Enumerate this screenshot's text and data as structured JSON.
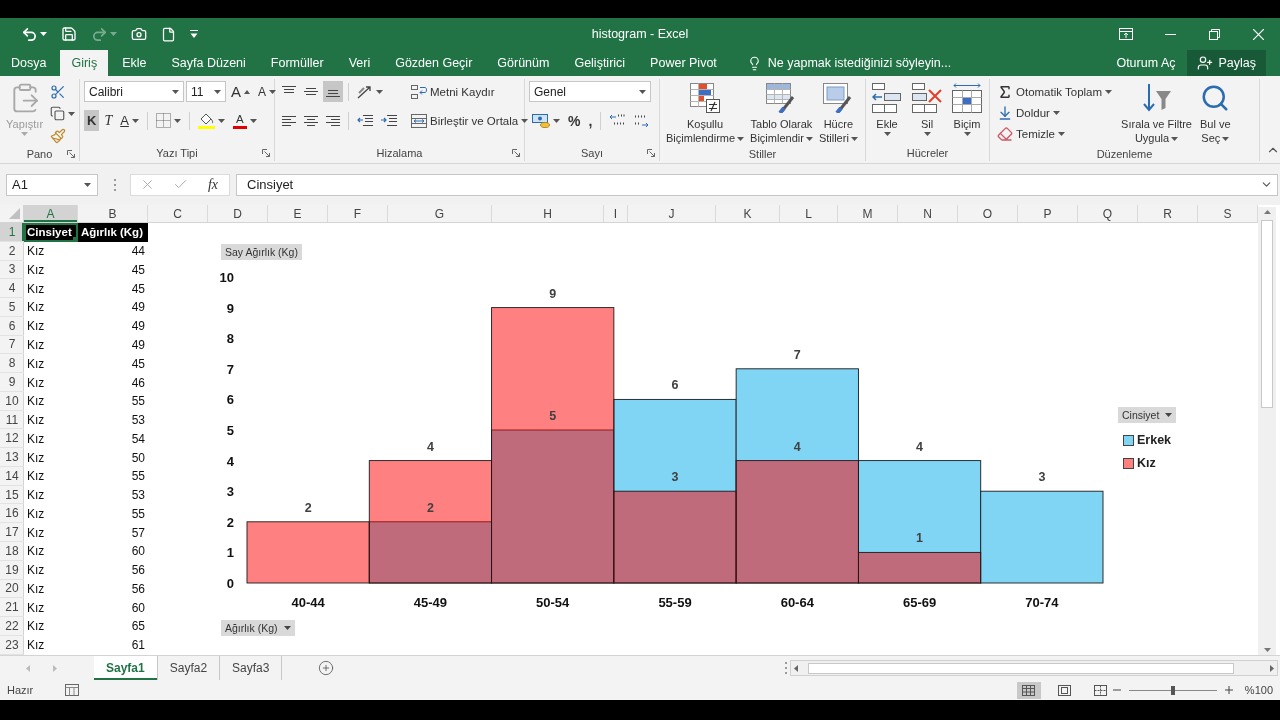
{
  "quick_access": [
    {
      "kind": "undo",
      "disabled": false
    },
    {
      "kind": "save",
      "disabled": false
    },
    {
      "kind": "redo",
      "disabled": true
    },
    {
      "kind": "camera",
      "disabled": false
    },
    {
      "kind": "new",
      "disabled": false
    },
    {
      "kind": "customize",
      "disabled": false
    }
  ],
  "window": {
    "title": "histogram - Excel"
  },
  "menu_tabs": [
    {
      "label": "Dosya",
      "selected": false
    },
    {
      "label": "Giriş",
      "selected": true
    },
    {
      "label": "Ekle",
      "selected": false
    },
    {
      "label": "Sayfa Düzeni",
      "selected": false
    },
    {
      "label": "Formüller",
      "selected": false
    },
    {
      "label": "Veri",
      "selected": false
    },
    {
      "label": "Gözden Geçir",
      "selected": false
    },
    {
      "label": "Görünüm",
      "selected": false
    },
    {
      "label": "Geliştirici",
      "selected": false
    },
    {
      "label": "Power Pivot",
      "selected": false
    }
  ],
  "tell_me": {
    "placeholder": "Ne yapmak istediğinizi söyleyin..."
  },
  "account": {
    "sign_in": "Oturum Aç",
    "share": "Paylaş"
  },
  "ribbon": {
    "clipboard": {
      "label": "Pano",
      "paste": {
        "label": "Yapıştır",
        "disabled": true
      }
    },
    "font": {
      "label": "Yazı Tipi",
      "font_name": "Calibri",
      "font_size": "11",
      "grow": "A",
      "shrink": "A",
      "bold": {
        "label": "K",
        "selected": true
      },
      "italic": {
        "label": "T",
        "selected": false
      },
      "underline": {
        "label": "A",
        "selected": false
      },
      "font_color": "A"
    },
    "alignment": {
      "label": "Hizalama",
      "vertical": [
        {
          "kind": "top",
          "selected": false
        },
        {
          "kind": "middle",
          "selected": false
        },
        {
          "kind": "bottom",
          "selected": true
        }
      ],
      "horizontal": [
        {
          "kind": "left",
          "selected": false
        },
        {
          "kind": "center",
          "selected": false
        },
        {
          "kind": "right",
          "selected": false
        }
      ],
      "wrap_text": "Metni Kaydır",
      "merge": "Birleştir ve Ortala"
    },
    "number": {
      "label": "Sayı",
      "format": "Genel",
      "percent": "%",
      "comma": ","
    },
    "styles": {
      "label": "Stiller",
      "buttons": [
        {
          "kind": "conditional",
          "lines": [
            "Koşullu",
            "Biçimlendirme"
          ]
        },
        {
          "kind": "table",
          "lines": [
            "Tablo Olarak",
            "Biçimlendir"
          ]
        },
        {
          "kind": "cell_styles",
          "lines": [
            "Hücre",
            "Stilleri"
          ]
        }
      ]
    },
    "cells": {
      "label": "Hücreler",
      "buttons": [
        {
          "kind": "insert",
          "label": "Ekle"
        },
        {
          "kind": "delete",
          "label": "Sil"
        },
        {
          "kind": "format",
          "label": "Biçim"
        }
      ]
    },
    "editing": {
      "label": "Düzenleme",
      "small": [
        {
          "kind": "autosum",
          "label": "Otomatik Toplam"
        },
        {
          "kind": "fill",
          "label": "Doldur"
        },
        {
          "kind": "clear",
          "label": "Temizle"
        }
      ],
      "big": [
        {
          "kind": "sort",
          "lines": [
            "Sırala ve Filtre",
            "Uygula"
          ]
        },
        {
          "kind": "find",
          "lines": [
            "Bul ve",
            "Seç"
          ]
        }
      ]
    }
  },
  "formula_bar": {
    "name_box": "A1",
    "function_label": "fx",
    "value": "Cinsiyet"
  },
  "sheet": {
    "columns": [
      {
        "label": "A",
        "selected": true
      },
      {
        "label": "B",
        "selected": false
      },
      {
        "label": "C",
        "selected": false
      },
      {
        "label": "D",
        "selected": false
      },
      {
        "label": "E",
        "selected": false
      },
      {
        "label": "F",
        "selected": false
      },
      {
        "label": "G",
        "selected": false
      },
      {
        "label": "H",
        "selected": false
      },
      {
        "label": "I",
        "selected": false
      },
      {
        "label": "J",
        "selected": false
      },
      {
        "label": "K",
        "selected": false
      },
      {
        "label": "L",
        "selected": false
      },
      {
        "label": "M",
        "selected": false
      },
      {
        "label": "N",
        "selected": false
      },
      {
        "label": "O",
        "selected": false
      },
      {
        "label": "P",
        "selected": false
      },
      {
        "label": "Q",
        "selected": false
      },
      {
        "label": "R",
        "selected": false
      },
      {
        "label": "S",
        "selected": false
      }
    ],
    "rows": [
      {
        "number": "1",
        "selected": true,
        "kind": "header",
        "cells": [
          "Cinsiyet",
          "Ağırlık (Kg)"
        ]
      },
      {
        "number": "2",
        "selected": false,
        "kind": "data",
        "cells": [
          "Kız",
          "44"
        ]
      },
      {
        "number": "3",
        "selected": false,
        "kind": "data",
        "cells": [
          "Kız",
          "45"
        ]
      },
      {
        "number": "4",
        "selected": false,
        "kind": "data",
        "cells": [
          "Kız",
          "45"
        ]
      },
      {
        "number": "5",
        "selected": false,
        "kind": "data",
        "cells": [
          "Kız",
          "49"
        ]
      },
      {
        "number": "6",
        "selected": false,
        "kind": "data",
        "cells": [
          "Kız",
          "49"
        ]
      },
      {
        "number": "7",
        "selected": false,
        "kind": "data",
        "cells": [
          "Kız",
          "49"
        ]
      },
      {
        "number": "8",
        "selected": false,
        "kind": "data",
        "cells": [
          "Kız",
          "45"
        ]
      },
      {
        "number": "9",
        "selected": false,
        "kind": "data",
        "cells": [
          "Kız",
          "46"
        ]
      },
      {
        "number": "10",
        "selected": false,
        "kind": "data",
        "cells": [
          "Kız",
          "55"
        ]
      },
      {
        "number": "11",
        "selected": false,
        "kind": "data",
        "cells": [
          "Kız",
          "53"
        ]
      },
      {
        "number": "12",
        "selected": false,
        "kind": "data",
        "cells": [
          "Kız",
          "54"
        ]
      },
      {
        "number": "13",
        "selected": false,
        "kind": "data",
        "cells": [
          "Kız",
          "50"
        ]
      },
      {
        "number": "14",
        "selected": false,
        "kind": "data",
        "cells": [
          "Kız",
          "55"
        ]
      },
      {
        "number": "15",
        "selected": false,
        "kind": "data",
        "cells": [
          "Kız",
          "53"
        ]
      },
      {
        "number": "16",
        "selected": false,
        "kind": "data",
        "cells": [
          "Kız",
          "55"
        ]
      },
      {
        "number": "17",
        "selected": false,
        "kind": "data",
        "cells": [
          "Kız",
          "57"
        ]
      },
      {
        "number": "18",
        "selected": false,
        "kind": "data",
        "cells": [
          "Kız",
          "60"
        ]
      },
      {
        "number": "19",
        "selected": false,
        "kind": "data",
        "cells": [
          "Kız",
          "56"
        ]
      },
      {
        "number": "20",
        "selected": false,
        "kind": "data",
        "cells": [
          "Kız",
          "56"
        ]
      },
      {
        "number": "21",
        "selected": false,
        "kind": "data",
        "cells": [
          "Kız",
          "60"
        ]
      },
      {
        "number": "22",
        "selected": false,
        "kind": "data",
        "cells": [
          "Kız",
          "65"
        ]
      },
      {
        "number": "23",
        "selected": false,
        "kind": "data",
        "cells": [
          "Kız",
          "61"
        ]
      }
    ],
    "chart": {
      "value_button": "Say Ağırlık (Kg)",
      "axis_button": "Ağırlık (Kg)",
      "legend_button": "Cinsiyet",
      "chart_data": [
        {
          "type": "bar",
          "categories": [
            "40-44",
            "45-49",
            "50-54",
            "55-59",
            "60-64",
            "65-69",
            "70-74"
          ],
          "series": [
            {
              "name": "Erkek",
              "color": "#80d5f5",
              "values": [
                null,
                2,
                5,
                6,
                7,
                4,
                3
              ]
            },
            {
              "name": "Kız",
              "color": "#ff8080",
              "values": [
                2,
                4,
                9,
                3,
                4,
                1,
                null
              ]
            }
          ],
          "ylim": [
            0,
            10
          ],
          "yticks": [
            0,
            1,
            2,
            3,
            4,
            5,
            6,
            7,
            8,
            9,
            10
          ],
          "data_labels": true,
          "legend": "right"
        }
      ]
    }
  },
  "sheet_tabs": [
    {
      "label": "Sayfa1",
      "selected": true
    },
    {
      "label": "Sayfa2",
      "selected": false
    },
    {
      "label": "Sayfa3",
      "selected": false
    }
  ],
  "status_bar": {
    "text": "Hazır",
    "views": [
      {
        "kind": "normal",
        "selected": true
      },
      {
        "kind": "page_layout",
        "selected": false
      },
      {
        "kind": "page_break",
        "selected": false
      }
    ],
    "zoom": {
      "level": 0.5,
      "label": "%100"
    }
  }
}
